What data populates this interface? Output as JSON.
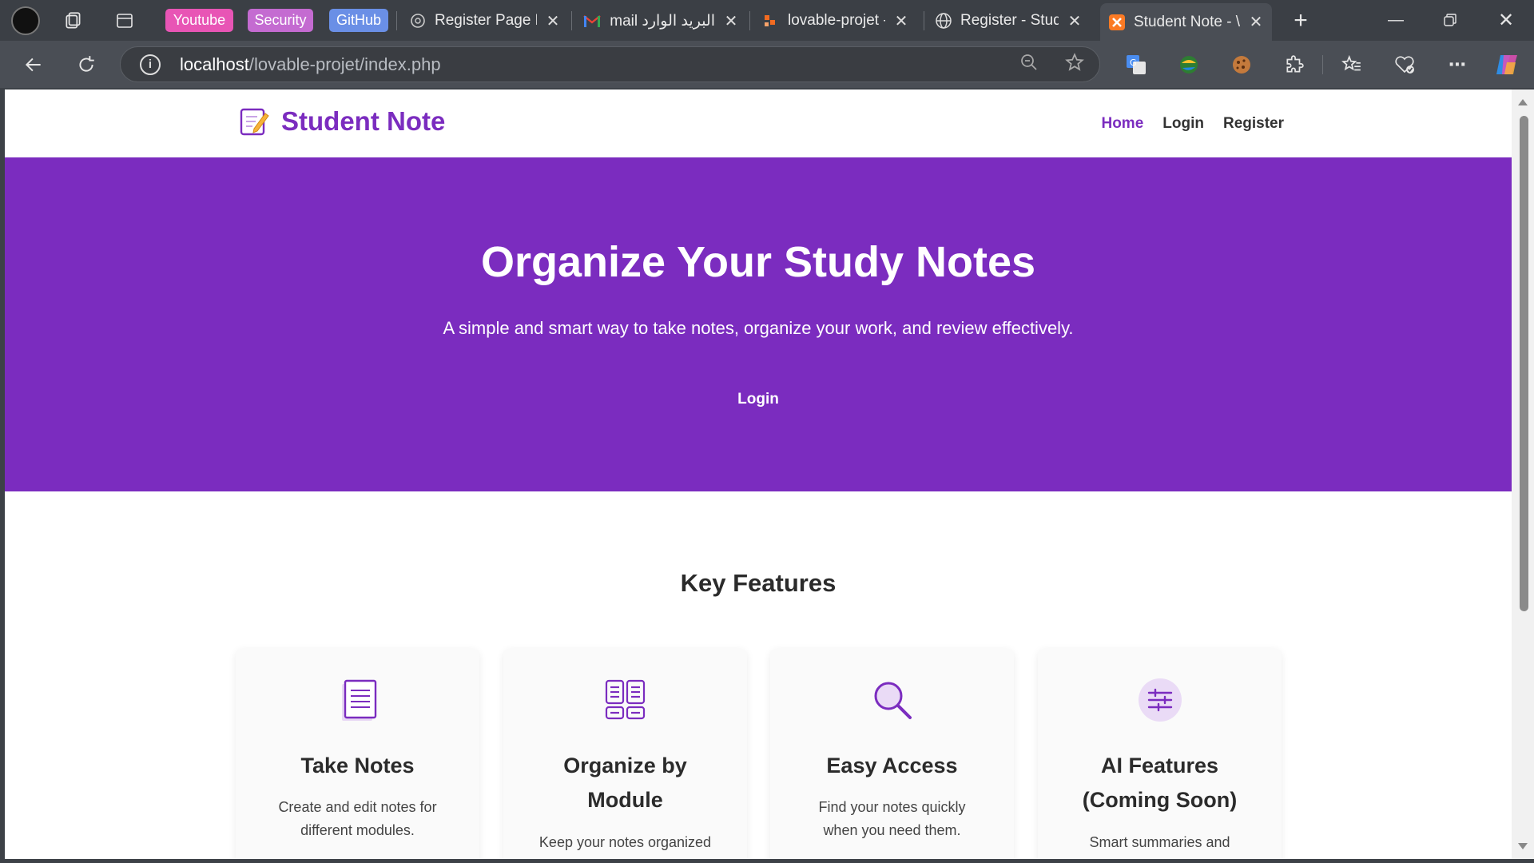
{
  "browser": {
    "bookmarks": [
      {
        "label": "Youtube",
        "color": "#e855b5"
      },
      {
        "label": "Security",
        "color": "#c46bd1"
      },
      {
        "label": "GitHub",
        "color": "#6a8fe6"
      }
    ],
    "tabs": [
      {
        "label": "Register Page De",
        "favicon": "openai-icon"
      },
      {
        "label": "البريد الوارد Gmail",
        "favicon": "gmail-icon"
      },
      {
        "label": "lovable-projet -",
        "favicon": "phpmyadmin-icon"
      },
      {
        "label": "Register - Stude",
        "favicon": "globe-icon"
      },
      {
        "label": "Student Note - \\",
        "favicon": "xampp-icon",
        "active": true
      }
    ],
    "address": {
      "host": "localhost",
      "path": "/lovable-projet/index.php"
    }
  },
  "site": {
    "brand": "Student Note",
    "brand_icon": "memo-icon",
    "accent": "#7b2cbf",
    "nav": [
      {
        "label": "Home",
        "active": true
      },
      {
        "label": "Login"
      },
      {
        "label": "Register"
      }
    ]
  },
  "hero": {
    "title": "Organize Your Study Notes",
    "subtitle": "A simple and smart way to take notes, organize your work, and review effectively.",
    "cta": "Login"
  },
  "features": {
    "title": "Key Features",
    "cards": [
      {
        "icon": "document-icon",
        "title": "Take Notes",
        "desc": "Create and edit notes for different modules."
      },
      {
        "icon": "grid-icon",
        "title": "Organize by Module",
        "desc": "Keep your notes organized"
      },
      {
        "icon": "search-icon",
        "title": "Easy Access",
        "desc": "Find your notes quickly when you need them."
      },
      {
        "icon": "sliders-icon",
        "title": "AI Features (Coming Soon)",
        "desc": "Smart summaries and"
      }
    ]
  }
}
